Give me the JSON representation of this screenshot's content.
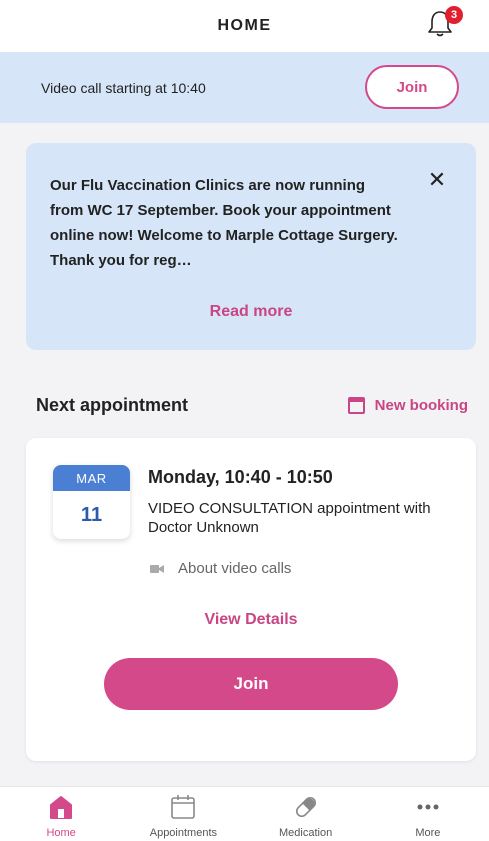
{
  "header": {
    "title": "HOME",
    "notification_count": "3"
  },
  "video_banner": {
    "text": "Video call starting at 10:40",
    "join_label": "Join"
  },
  "notice": {
    "text": "Our Flu Vaccination Clinics are now running from WC 17 September. Book your appointment online now! Welcome to Marple Cottage Surgery. Thank you for reg…",
    "read_more_label": "Read more",
    "close_symbol": "✕"
  },
  "appointments": {
    "section_title": "Next appointment",
    "new_booking_label": "New booking",
    "next": {
      "month": "MAR",
      "day": "11",
      "time": "Monday, 10:40 - 10:50",
      "description": "VIDEO CONSULTATION appointment with Doctor Unknown",
      "about_video_label": "About video calls",
      "view_details_label": "View Details",
      "join_label": "Join"
    }
  },
  "tabbar": {
    "items": [
      {
        "label": "Home",
        "icon": "home-icon",
        "active": true
      },
      {
        "label": "Appointments",
        "icon": "calendar-icon",
        "active": false
      },
      {
        "label": "Medication",
        "icon": "pill-icon",
        "active": false
      },
      {
        "label": "More",
        "icon": "more-icon",
        "active": false
      }
    ]
  },
  "colors": {
    "accent": "#d4498a",
    "banner_bg": "#d6e6f8",
    "date_blue": "#4a7fd4",
    "badge_red": "#e0202e"
  }
}
